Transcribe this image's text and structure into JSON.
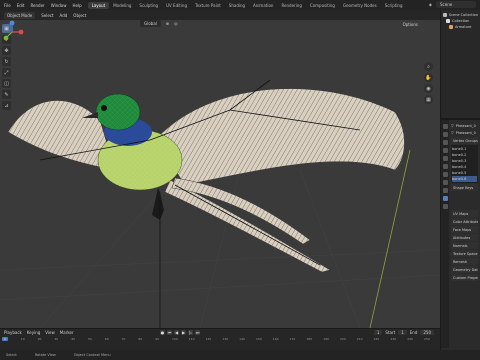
{
  "top_menu": [
    "File",
    "Edit",
    "Render",
    "Window",
    "Help"
  ],
  "workspaces": [
    "Layout",
    "Modeling",
    "Sculpting",
    "UV Editing",
    "Texture Paint",
    "Shading",
    "Animation",
    "Rendering",
    "Compositing",
    "Geometry Nodes",
    "Scripting"
  ],
  "active_workspace": "Layout",
  "scene_label": "Scene",
  "header2": {
    "mode": "Object Mode",
    "menus": [
      "Select",
      "Add",
      "Object"
    ]
  },
  "viewport_header": {
    "orientation": "Global",
    "pivot": "Options"
  },
  "tools": [
    "cursor",
    "move",
    "rotate",
    "scale",
    "transform",
    "annotate",
    "measure"
  ],
  "outliner": {
    "rows": [
      {
        "label": "Scene Collection",
        "indent": 0,
        "color": "#ffffff"
      },
      {
        "label": "Collection",
        "indent": 1,
        "color": "#ffffff"
      },
      {
        "label": "Armature",
        "indent": 2,
        "color": "#e0a060"
      }
    ]
  },
  "properties": {
    "object_name": "Pheasant_0",
    "data_name": "Pheasant_0",
    "vertex_groups_label": "Vertex Groups",
    "vertex_groups": [
      "bone0.1",
      "bone0.2",
      "bone0.3",
      "bone0.4",
      "bone0.5",
      "bone0.6"
    ],
    "selected_group": "bone0.6",
    "shape_keys_label": "Shape Keys",
    "sections": [
      "UV Maps",
      "Color Attributes",
      "Face Maps",
      "Attributes",
      "Normals",
      "Texture Space",
      "Remesh",
      "Geometry Data",
      "Custom Properties"
    ]
  },
  "timeline": {
    "menus": [
      "Playback",
      "Keying",
      "View",
      "Marker"
    ],
    "current_frame": "1",
    "start_label": "Start",
    "start": "1",
    "end_label": "End",
    "end": "250",
    "ticks": [
      "0",
      "10",
      "20",
      "30",
      "40",
      "50",
      "60",
      "70",
      "80",
      "90",
      "100",
      "110",
      "120",
      "130",
      "140",
      "150",
      "160",
      "170",
      "180",
      "190",
      "200",
      "210",
      "220",
      "230",
      "240",
      "250"
    ]
  },
  "statusbar": {
    "select": "Select",
    "rotate": "Rotate View",
    "context": "Object Context Menu"
  },
  "colors": {
    "accent": "#4d79c7",
    "viewport_bg": "#3a3a3a",
    "bird_head": "#1e8a3a",
    "bird_collar": "#2a4a9a",
    "bird_breast": "#b6d36a"
  }
}
